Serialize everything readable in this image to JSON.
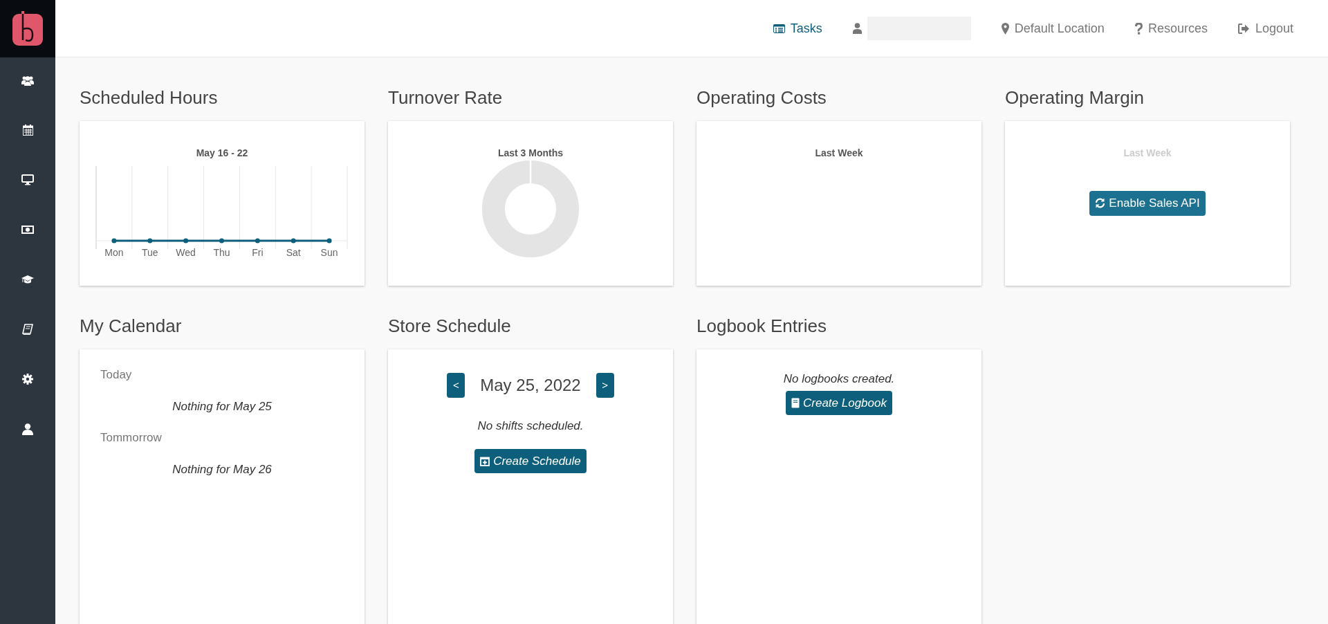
{
  "navbar": {
    "items": [
      {
        "kind": "link",
        "label": "Tasks",
        "selected": true
      },
      {
        "kind": "user"
      },
      {
        "kind": "link",
        "label": "Default Location",
        "selected": false
      },
      {
        "kind": "link",
        "label": "Resources",
        "selected": false
      },
      {
        "kind": "link",
        "label": "Logout",
        "selected": false
      }
    ]
  },
  "widgets": [
    {
      "kind": "line",
      "title": "Scheduled Hours",
      "subtitle": "May 16 - 22",
      "subtitle_muted": false,
      "days": [
        "Mon",
        "Tue",
        "Wed",
        "Thu",
        "Fri",
        "Sat",
        "Sun"
      ]
    },
    {
      "kind": "donut",
      "title": "Turnover Rate",
      "subtitle": "Last 3 Months",
      "subtitle_muted": false
    },
    {
      "kind": "empty",
      "title": "Operating Costs",
      "subtitle": "Last Week",
      "subtitle_muted": false
    },
    {
      "kind": "api",
      "title": "Operating Margin",
      "subtitle": "Last Week",
      "subtitle_muted": true,
      "button": "Enable Sales API"
    },
    {
      "kind": "calendar",
      "title": "My Calendar",
      "entries": [
        {
          "day": "Today",
          "note": "Nothing for May 25"
        },
        {
          "day": "Tommorrow",
          "note": "Nothing for May 26"
        }
      ]
    },
    {
      "kind": "schedule",
      "title": "Store Schedule",
      "prev": "<",
      "date": "May 25, 2022",
      "next": ">",
      "note": "No shifts scheduled.",
      "button": "Create Schedule"
    },
    {
      "kind": "logbook",
      "title": "Logbook Entries",
      "note": "No logbooks created.",
      "button": "Create Logbook"
    }
  ]
}
